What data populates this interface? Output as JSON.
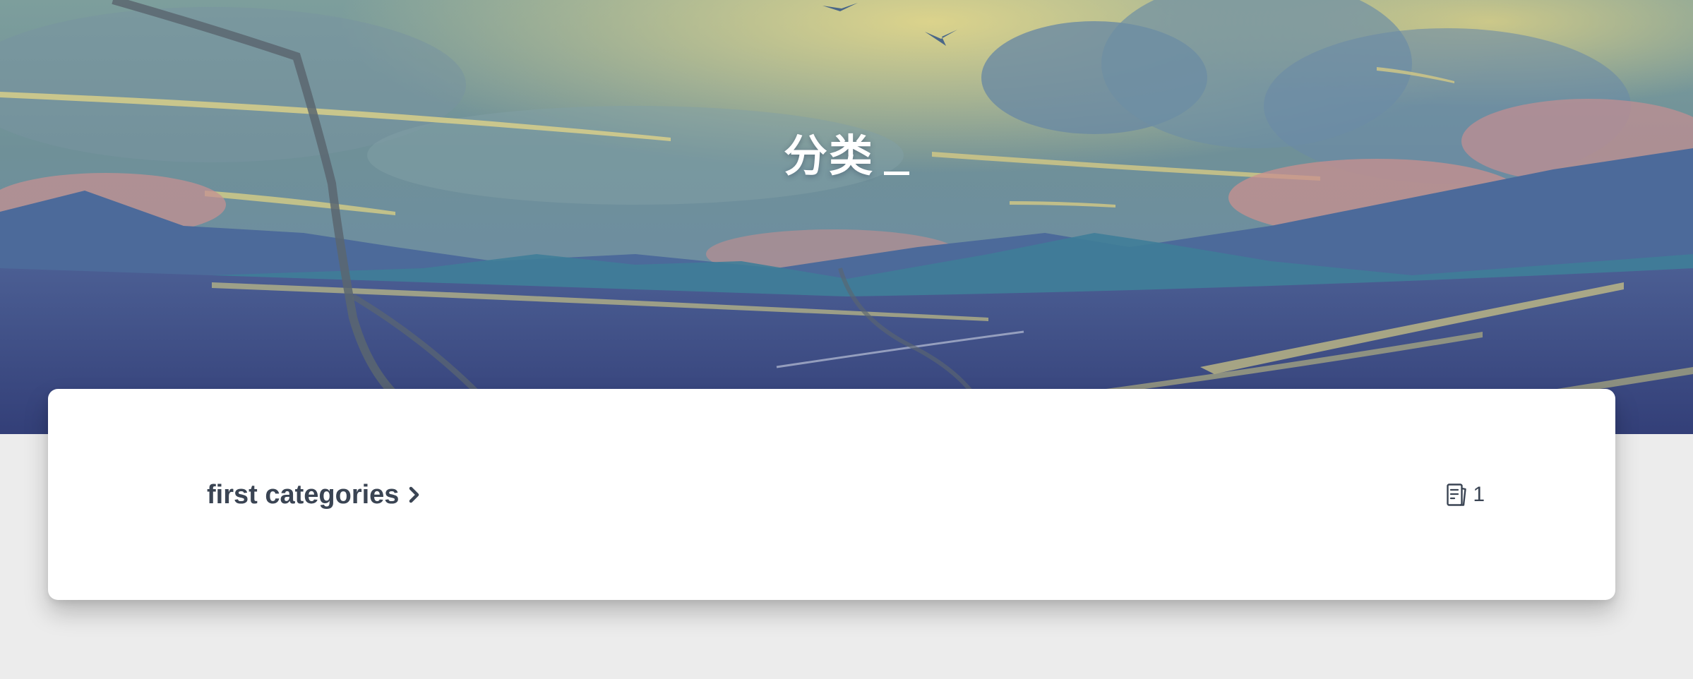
{
  "hero": {
    "title": "分类",
    "cursor": "_"
  },
  "categories": [
    {
      "label": "first categories",
      "icon": "chevron-right-icon",
      "count_icon": "document-icon",
      "count": "1"
    }
  ],
  "colors": {
    "page_background": "#ececec",
    "card_background": "#ffffff",
    "text": "#3a4453",
    "hero_title": "#ffffff"
  }
}
